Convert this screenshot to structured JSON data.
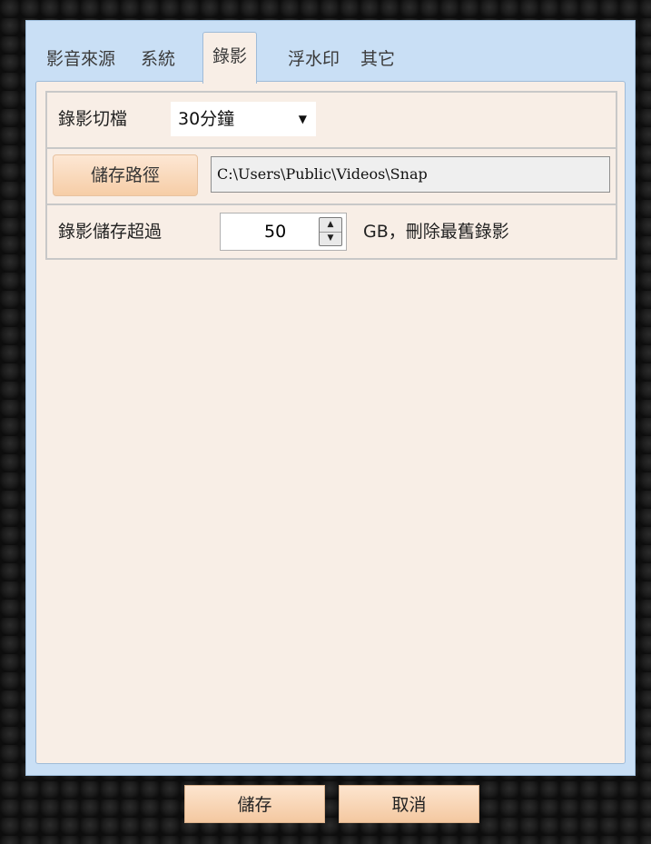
{
  "tabs": [
    {
      "label": "影音來源"
    },
    {
      "label": "系統"
    },
    {
      "label": "錄影"
    },
    {
      "label": "浮水印"
    },
    {
      "label": "其它"
    }
  ],
  "recording": {
    "split_label": "錄影切檔",
    "split_value": "30分鐘",
    "save_path_button": "儲存路徑",
    "save_path_value": "C:\\Users\\Public\\Videos\\Snap",
    "limit_label": "錄影儲存超過",
    "limit_value": "50",
    "limit_suffix": "GB，刪除最舊錄影"
  },
  "footer": {
    "save_label": "儲存",
    "cancel_label": "取消"
  },
  "colors": {
    "dialog_bg": "#c9dff5",
    "panel_bg": "#f8eee6",
    "button_peach": "#f6cda6"
  }
}
